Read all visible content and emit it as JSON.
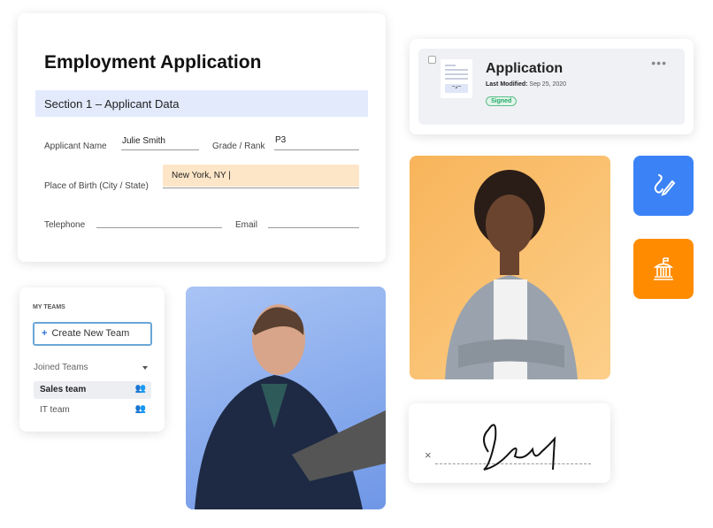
{
  "form": {
    "title": "Employment Application",
    "section": "Section 1 – Applicant Data",
    "fields": {
      "applicant_name_label": "Applicant Name",
      "applicant_name": "Julie Smith",
      "grade_label": "Grade / Rank",
      "grade": "P3",
      "birth_label": "Place of Birth (City / State)",
      "birth": "New York, NY |",
      "telephone_label": "Telephone",
      "email_label": "Email"
    }
  },
  "document": {
    "title": "Application",
    "modified_label": "Last Modified:",
    "modified": "Sep 25, 2020",
    "status": "Signed",
    "status_color": "#5bbf8a",
    "menu_icon": "more-horizontal-icon"
  },
  "actions": [
    {
      "icon": "signature-pen-icon",
      "color": "#3b82f6"
    },
    {
      "icon": "government-building-icon",
      "color": "#ff8c00"
    }
  ],
  "teams": {
    "heading": "MY TEAMS",
    "create_label": "Create New Team",
    "joined_label": "Joined Teams",
    "items": [
      {
        "label": "Sales team",
        "selected": true
      },
      {
        "label": "IT team",
        "selected": false
      }
    ]
  },
  "signature": {
    "mark": "×"
  }
}
